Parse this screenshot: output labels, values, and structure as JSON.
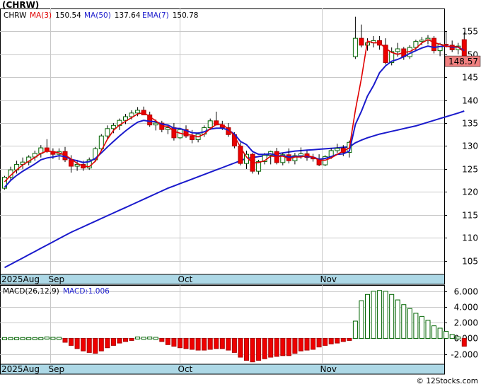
{
  "chart_data": [
    {
      "type": "candlestick",
      "title": "(CHRW)",
      "legend": [
        {
          "label": "CHRW",
          "color": "#000000"
        },
        {
          "label": "MA(3)",
          "value": "150.54",
          "color": "#e00000"
        },
        {
          "label": "MA(50)",
          "value": "137.64",
          "color": "#1a1acc"
        },
        {
          "label": "EMA(7)",
          "value": "150.78",
          "color": "#1a1acc"
        }
      ],
      "legend_placement": "top-left",
      "last_price_label": "148.57",
      "ylim": [
        102,
        160
      ],
      "y_ticks": [
        105,
        110,
        115,
        120,
        125,
        130,
        135,
        140,
        145,
        150,
        155
      ],
      "x_ticks": [
        {
          "label": "Sep",
          "index": 15
        },
        {
          "label": "Oct",
          "index": 58
        },
        {
          "label": "Nov",
          "index": 105
        }
      ],
      "x_start_label": "2025Aug",
      "grid": true,
      "candles": [
        [
          120.8,
          123.5,
          120.5,
          123.2
        ],
        [
          123.2,
          125.5,
          122.5,
          124.8
        ],
        [
          124.8,
          126.8,
          124.0,
          126.0
        ],
        [
          126.0,
          127.5,
          125.0,
          126.5
        ],
        [
          126.5,
          128.0,
          125.8,
          127.6
        ],
        [
          127.6,
          129.0,
          126.8,
          128.4
        ],
        [
          128.4,
          130.2,
          127.5,
          129.6
        ],
        [
          129.6,
          131.5,
          128.5,
          128.8
        ],
        [
          128.8,
          129.5,
          127.2,
          128.2
        ],
        [
          128.2,
          129.5,
          127.0,
          128.8
        ],
        [
          128.8,
          129.8,
          126.5,
          127.0
        ],
        [
          127.0,
          128.0,
          124.2,
          125.6
        ],
        [
          125.6,
          127.0,
          124.6,
          126.0
        ],
        [
          126.0,
          126.8,
          124.6,
          125.2
        ],
        [
          125.2,
          127.5,
          124.8,
          127.0
        ],
        [
          127.0,
          129.8,
          126.5,
          129.4
        ],
        [
          129.4,
          132.6,
          129.0,
          132.2
        ],
        [
          132.2,
          134.5,
          131.5,
          133.8
        ],
        [
          133.8,
          135.0,
          132.8,
          134.5
        ],
        [
          134.5,
          136.0,
          133.5,
          135.6
        ],
        [
          135.6,
          137.0,
          134.8,
          136.4
        ],
        [
          136.4,
          137.8,
          135.8,
          137.2
        ],
        [
          137.2,
          138.5,
          136.5,
          137.8
        ],
        [
          137.8,
          138.6,
          136.8,
          136.8
        ],
        [
          136.8,
          137.5,
          134.2,
          134.6
        ],
        [
          134.6,
          135.8,
          133.4,
          135.0
        ],
        [
          135.0,
          135.5,
          133.0,
          133.6
        ],
        [
          133.6,
          134.5,
          132.6,
          134.0
        ],
        [
          134.0,
          135.0,
          131.2,
          131.8
        ],
        [
          131.8,
          134.0,
          131.5,
          133.6
        ],
        [
          133.6,
          134.5,
          131.8,
          132.2
        ],
        [
          132.2,
          133.5,
          130.6,
          131.4
        ],
        [
          131.4,
          133.0,
          130.8,
          132.6
        ],
        [
          132.6,
          134.5,
          132.0,
          134.0
        ],
        [
          134.0,
          136.0,
          133.5,
          135.5
        ],
        [
          135.5,
          137.5,
          134.5,
          134.6
        ],
        [
          134.6,
          135.5,
          133.5,
          134.0
        ],
        [
          134.0,
          135.0,
          132.0,
          132.5
        ],
        [
          132.5,
          133.0,
          129.5,
          130.0
        ],
        [
          130.0,
          130.8,
          125.8,
          126.2
        ],
        [
          126.2,
          129.0,
          125.0,
          128.2
        ],
        [
          128.2,
          128.5,
          124.0,
          124.5
        ],
        [
          124.5,
          127.0,
          123.8,
          126.6
        ],
        [
          126.6,
          128.5,
          126.0,
          128.0
        ],
        [
          128.0,
          129.0,
          126.0,
          128.8
        ],
        [
          128.8,
          129.6,
          126.0,
          126.4
        ],
        [
          126.4,
          128.5,
          125.8,
          128.1
        ],
        [
          128.1,
          129.5,
          126.2,
          126.8
        ],
        [
          126.8,
          128.5,
          126.0,
          127.9
        ],
        [
          127.9,
          129.7,
          127.2,
          128.3
        ],
        [
          128.3,
          129.0,
          126.8,
          127.5
        ],
        [
          127.5,
          128.3,
          126.6,
          127.2
        ],
        [
          127.2,
          128.2,
          125.6,
          125.9
        ],
        [
          125.9,
          128.0,
          125.6,
          127.7
        ],
        [
          127.7,
          129.5,
          127.2,
          129.0
        ],
        [
          129.0,
          130.5,
          128.5,
          129.5
        ],
        [
          129.5,
          130.2,
          127.8,
          128.6
        ],
        [
          128.6,
          131.2,
          127.5,
          130.8
        ],
        [
          149.5,
          158.2,
          149.0,
          153.5
        ],
        [
          153.5,
          156.5,
          151.5,
          152.0
        ],
        [
          152.0,
          153.5,
          150.8,
          152.5
        ],
        [
          152.5,
          154.0,
          151.5,
          153.0
        ],
        [
          153.0,
          154.0,
          151.0,
          152.0
        ],
        [
          152.0,
          153.5,
          147.8,
          148.2
        ],
        [
          148.2,
          151.5,
          147.6,
          150.6
        ],
        [
          150.6,
          152.5,
          149.5,
          151.2
        ],
        [
          151.2,
          151.6,
          148.8,
          149.5
        ],
        [
          149.5,
          152.0,
          149.0,
          151.5
        ],
        [
          151.5,
          153.2,
          150.8,
          152.8
        ],
        [
          152.8,
          153.8,
          152.0,
          153.1
        ],
        [
          153.1,
          154.2,
          152.2,
          153.5
        ],
        [
          153.5,
          154.0,
          150.2,
          150.8
        ],
        [
          150.8,
          152.5,
          149.6,
          152.2
        ],
        [
          152.2,
          155.0,
          151.5,
          152.0
        ],
        [
          152.0,
          153.0,
          150.5,
          151.0
        ],
        [
          151.0,
          152.5,
          150.0,
          151.8
        ],
        [
          153.2,
          154.8,
          148.4,
          148.57
        ]
      ],
      "ma3": [
        122.2,
        123.6,
        124.8,
        125.9,
        126.7,
        127.5,
        128.4,
        128.9,
        128.8,
        128.5,
        128.0,
        127.2,
        126.2,
        125.6,
        125.5,
        126.7,
        129.0,
        131.5,
        133.4,
        134.6,
        135.4,
        136.2,
        137.0,
        137.3,
        136.4,
        135.5,
        134.4,
        134.3,
        133.2,
        132.8,
        132.5,
        132.4,
        132.0,
        132.6,
        133.8,
        134.7,
        134.7,
        133.7,
        132.2,
        129.7,
        127.6,
        126.3,
        126.4,
        126.8,
        127.8,
        127.7,
        127.8,
        127.2,
        127.6,
        127.6,
        127.9,
        127.6,
        126.9,
        126.9,
        127.4,
        128.2,
        128.9,
        129.6,
        137.8,
        144.8,
        152.9,
        152.5,
        152.5,
        151.3,
        150.4,
        150.0,
        150.4,
        150.6,
        151.3,
        152.5,
        153.2,
        152.6,
        152.2,
        151.7,
        151.8,
        151.6,
        150.5
      ],
      "ema7": [
        121.0,
        122.5,
        123.6,
        124.5,
        125.3,
        126.1,
        127.0,
        127.4,
        127.6,
        127.9,
        127.7,
        127.1,
        126.8,
        126.4,
        126.6,
        127.3,
        128.5,
        129.8,
        131.0,
        132.2,
        133.3,
        134.3,
        135.2,
        135.6,
        135.4,
        135.3,
        134.8,
        134.6,
        133.9,
        133.8,
        133.4,
        132.9,
        132.8,
        133.1,
        133.7,
        133.9,
        133.9,
        133.5,
        132.6,
        131.0,
        130.3,
        128.8,
        128.2,
        128.2,
        128.3,
        127.8,
        127.9,
        127.6,
        127.7,
        127.8,
        127.7,
        127.6,
        127.1,
        127.3,
        127.7,
        128.2,
        128.3,
        128.9,
        134.7,
        137.6,
        140.9,
        143.2,
        146.0,
        147.5,
        148.5,
        148.9,
        149.5,
        150.2,
        150.8,
        151.4,
        151.8,
        151.5,
        151.7,
        151.8,
        151.6,
        151.6,
        150.78
      ],
      "ma50": [
        103.5,
        104.2,
        104.9,
        105.6,
        106.3,
        107.0,
        107.7,
        108.4,
        109.1,
        109.8,
        110.5,
        111.2,
        111.8,
        112.4,
        113.0,
        113.6,
        114.2,
        114.8,
        115.4,
        116.0,
        116.6,
        117.2,
        117.8,
        118.4,
        119.0,
        119.6,
        120.2,
        120.8,
        121.3,
        121.8,
        122.3,
        122.8,
        123.3,
        123.8,
        124.3,
        124.8,
        125.3,
        125.8,
        126.3,
        126.8,
        127.3,
        127.5,
        127.7,
        127.9,
        128.1,
        128.3,
        128.5,
        128.7,
        128.9,
        129.0,
        129.1,
        129.2,
        129.3,
        129.4,
        129.5,
        129.6,
        129.7,
        129.8,
        130.7,
        131.3,
        131.8,
        132.2,
        132.6,
        132.9,
        133.2,
        133.5,
        133.8,
        134.1,
        134.4,
        134.8,
        135.2,
        135.6,
        136.0,
        136.4,
        136.8,
        137.2,
        137.64
      ]
    },
    {
      "type": "bar",
      "title": "MACD(26,12,9)",
      "legend": [
        {
          "label": "MACD:",
          "value": "-1.006",
          "color": "#1a1acc"
        }
      ],
      "legend_placement": "top-left",
      "ylim": [
        -3.3,
        6.8
      ],
      "y_ticks": [
        6.0,
        4.0,
        2.0,
        0.0,
        -2.0
      ],
      "y_tick_labels": [
        "6.000",
        "4.000",
        "2.000",
        "0.000",
        "-2.000"
      ],
      "x_ticks": [
        {
          "label": "Sep",
          "index": 15
        },
        {
          "label": "Oct",
          "index": 58
        },
        {
          "label": "Nov",
          "index": 105
        }
      ],
      "x_start_label": "2025Aug",
      "grid": true,
      "values": [
        0.1,
        0.1,
        0.1,
        0.1,
        0.1,
        0.1,
        0.1,
        0.05,
        0.0,
        0.0,
        -0.5,
        -0.9,
        -1.3,
        -1.6,
        -1.8,
        -1.9,
        -1.6,
        -1.2,
        -0.9,
        -0.6,
        -0.4,
        -0.1,
        0.05,
        0.15,
        0.05,
        0.0,
        -0.4,
        -0.8,
        -1.0,
        -1.2,
        -1.3,
        -1.4,
        -1.5,
        -1.5,
        -1.4,
        -1.3,
        -1.3,
        -1.5,
        -1.8,
        -2.4,
        -2.8,
        -3.0,
        -2.8,
        -2.6,
        -2.4,
        -2.3,
        -2.2,
        -2.2,
        -1.9,
        -1.6,
        -1.5,
        -1.4,
        -1.1,
        -0.9,
        -0.7,
        -0.6,
        -0.4,
        -0.2,
        2.2,
        4.8,
        5.6,
        6.0,
        6.1,
        6.0,
        5.6,
        4.9,
        4.3,
        3.8,
        3.2,
        2.8,
        2.3,
        1.6,
        1.3,
        0.9,
        0.5,
        0.2,
        -1.0
      ]
    }
  ],
  "footer": {
    "copyright": "© 12Stocks.com"
  }
}
